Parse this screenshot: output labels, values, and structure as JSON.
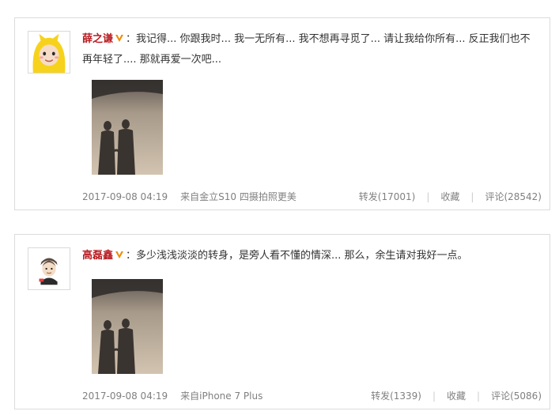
{
  "posts": [
    {
      "username": "薛之谦",
      "colon": "：",
      "text": "我记得... 你跟我时... 我一无所有... 我不想再寻觅了... 请让我给你所有... 反正我们也不再年轻了.... 那就再爱一次吧...",
      "date": "2017-09-08 04:19",
      "source": "来自金立S10 四摄拍照更美",
      "repost": "转发(17001)",
      "favorite": "收藏",
      "comment": "评论(28542)",
      "avatar_icon": "yellow-hood-avatar-icon",
      "separator": "|"
    },
    {
      "username": "高磊鑫",
      "colon": "：",
      "text": "多少浅浅淡淡的转身，是旁人看不懂的情深... 那么，余生请对我好一点。",
      "date": "2017-09-08 04:19",
      "source": "来自iPhone 7 Plus",
      "repost": "转发(1339)",
      "favorite": "收藏",
      "comment": "评论(5086)",
      "avatar_icon": "cartoon-boy-avatar-icon",
      "separator": "|"
    }
  ],
  "colors": {
    "username": "#b81c22",
    "vip_badge": "#f08a00",
    "meta_text": "#808080",
    "border": "#dcdcdc"
  }
}
